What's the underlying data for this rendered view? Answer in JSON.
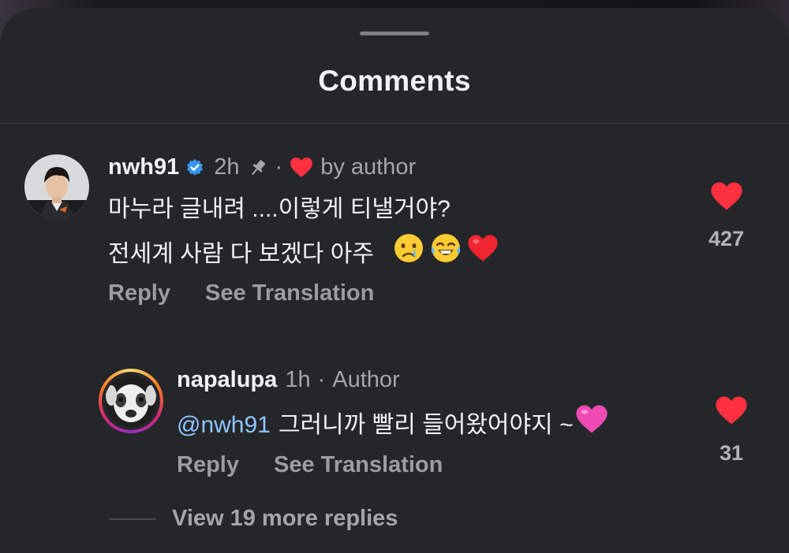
{
  "sheet": {
    "title": "Comments"
  },
  "comments": [
    {
      "username": "nwh91",
      "verified": true,
      "time": "2h",
      "pinned": true,
      "liked_by": "by author",
      "lines": [
        "마누라 글내려 ....이렇게 티낼거야?",
        "전세계 사람 다 보겠다 아주"
      ],
      "emojis": [
        "crying-face-icon",
        "tears-of-joy-icon",
        "red-heart-icon"
      ],
      "like_count": "427",
      "reply_label": "Reply",
      "translate_label": "See Translation"
    },
    {
      "username": "napalupa",
      "time": "1h",
      "role": "Author",
      "mention": "@nwh91",
      "text": "그러니까 빨리 들어왔어야지 ~",
      "emojis": [
        "pink-heart-icon"
      ],
      "like_count": "31",
      "reply_label": "Reply",
      "translate_label": "See Translation"
    }
  ],
  "replies_toggle": {
    "label": "View 19 more replies"
  },
  "colors": {
    "background": "#25262a",
    "like_red": "#ff3040",
    "verified_blue": "#3897f0",
    "mention_blue": "#8ec5ff"
  }
}
